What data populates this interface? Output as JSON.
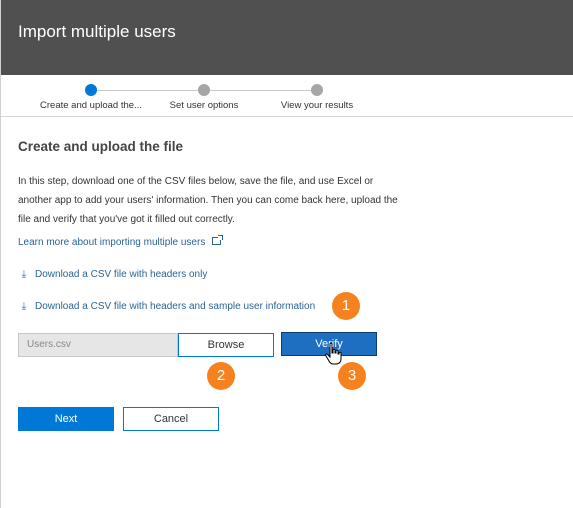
{
  "header": {
    "title": "Import multiple users",
    "bg_color": "#505050"
  },
  "stepper": {
    "steps": [
      {
        "label": "Create and upload the...",
        "state": "active"
      },
      {
        "label": "Set user options",
        "state": "pending"
      },
      {
        "label": "View your results",
        "state": "pending"
      }
    ],
    "active_color": "#0078d7"
  },
  "main": {
    "title": "Create and upload the file",
    "intro": "In this step, download one of the CSV files below, save the file, and use Excel or another app to add your users' information. Then you can come back here, upload the file and verify that you've got it filled out correctly.",
    "learn_more_link": "Learn more about importing multiple users",
    "learn_more_icon": "external-link-icon",
    "downloads": [
      {
        "label": "Download a CSV file with headers only",
        "icon": "download-icon"
      },
      {
        "label": "Download a CSV file with headers and sample user information",
        "icon": "download-icon"
      }
    ],
    "upload": {
      "file_placeholder": "Users.csv",
      "browse_label": "Browse",
      "verify_label": "Verify"
    }
  },
  "footer": {
    "next_label": "Next",
    "cancel_label": "Cancel"
  },
  "callouts": [
    "1",
    "2",
    "3"
  ],
  "callout_color": "#f5821f",
  "cursor_icon": "hand-pointer-icon"
}
